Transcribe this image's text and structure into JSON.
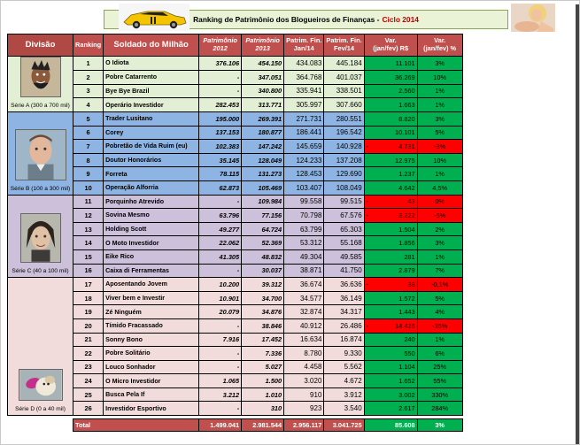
{
  "header": {
    "title": "Ranking de Patrimônio dos Blogueiros de Finanças -",
    "cycle": "Ciclo 2014"
  },
  "columns": {
    "divisao": "Divisão",
    "ranking": "Ranking",
    "soldado": "Soldado do Milhão",
    "p2012": "Patrimônio",
    "p2012y": "2012",
    "p2013": "Patrimônio",
    "p2013y": "2013",
    "jan": "Patrim. Fin.",
    "jany": "Jan/14",
    "fev": "Patrim. Fin.",
    "fevy": "Fev/14",
    "var": "Var.",
    "vary": "(jan/fev) R$",
    "varp": "Var.",
    "varpy": "(jan/fev) %"
  },
  "divisions": [
    {
      "label": "Série A (300 a 700 mil)"
    },
    {
      "label": "Série B (100 a 300 mil)"
    },
    {
      "label": "Série C (40 a 100 mil)"
    },
    {
      "label": "Série D (0 a 40 mil)"
    }
  ],
  "rows": [
    {
      "rank": "1",
      "name": "O Idiota",
      "p2012": "376.106",
      "p2013": "454.150",
      "jan": "434.083",
      "fev": "445.184",
      "var": "11.101",
      "pct": "3%",
      "neg": false
    },
    {
      "rank": "2",
      "name": "Pobre Catarrento",
      "p2012": "-",
      "p2013": "347.051",
      "jan": "364.768",
      "fev": "401.037",
      "var": "36.269",
      "pct": "10%",
      "neg": false
    },
    {
      "rank": "3",
      "name": "Bye Bye Brazil",
      "p2012": "-",
      "p2013": "340.800",
      "jan": "335.941",
      "fev": "338.501",
      "var": "2.560",
      "pct": "1%",
      "neg": false
    },
    {
      "rank": "4",
      "name": "Operário Investidor",
      "p2012": "282.453",
      "p2013": "313.771",
      "jan": "305.997",
      "fev": "307.660",
      "var": "1.663",
      "pct": "1%",
      "neg": false
    },
    {
      "rank": "5",
      "name": "Trader Lusitano",
      "p2012": "195.000",
      "p2013": "269.391",
      "jan": "271.731",
      "fev": "280.551",
      "var": "8.820",
      "pct": "3%",
      "neg": false
    },
    {
      "rank": "6",
      "name": "Corey",
      "p2012": "137.153",
      "p2013": "180.877",
      "jan": "186.441",
      "fev": "196.542",
      "var": "10.101",
      "pct": "5%",
      "neg": false
    },
    {
      "rank": "7",
      "name": "Pobretão de Vida Ruim (eu)",
      "p2012": "102.383",
      "p2013": "147.242",
      "jan": "145.659",
      "fev": "140.928",
      "var": "4.731",
      "pct": "-3%",
      "neg": true
    },
    {
      "rank": "8",
      "name": "Doutor Honorários",
      "p2012": "35.145",
      "p2013": "128.049",
      "jan": "124.233",
      "fev": "137.208",
      "var": "12.975",
      "pct": "10%",
      "neg": false
    },
    {
      "rank": "9",
      "name": "Forreta",
      "p2012": "78.115",
      "p2013": "131.273",
      "jan": "128.453",
      "fev": "129.690",
      "var": "1.237",
      "pct": "1%",
      "neg": false
    },
    {
      "rank": "10",
      "name": "Operação Alforria",
      "p2012": "62.873",
      "p2013": "105.469",
      "jan": "103.407",
      "fev": "108.049",
      "var": "4.642",
      "pct": "4,5%",
      "neg": false
    },
    {
      "rank": "11",
      "name": "Porquinho Atrevido",
      "p2012": "-",
      "p2013": "109.984",
      "jan": "99.558",
      "fev": "99.515",
      "var": "43",
      "pct": "0%",
      "neg": true
    },
    {
      "rank": "12",
      "name": "Sovina Mesmo",
      "p2012": "63.796",
      "p2013": "77.156",
      "jan": "70.798",
      "fev": "67.576",
      "var": "3.222",
      "pct": "-5%",
      "neg": true
    },
    {
      "rank": "13",
      "name": "Holding Scott",
      "p2012": "49.277",
      "p2013": "64.724",
      "jan": "63.799",
      "fev": "65.303",
      "var": "1.504",
      "pct": "2%",
      "neg": false
    },
    {
      "rank": "14",
      "name": "O Moto Investidor",
      "p2012": "22.062",
      "p2013": "52.369",
      "jan": "53.312",
      "fev": "55.168",
      "var": "1.856",
      "pct": "3%",
      "neg": false
    },
    {
      "rank": "15",
      "name": "Eike Rico",
      "p2012": "41.305",
      "p2013": "48.832",
      "jan": "49.304",
      "fev": "49.585",
      "var": "281",
      "pct": "1%",
      "neg": false
    },
    {
      "rank": "16",
      "name": "Caixa di Ferramentas",
      "p2012": "-",
      "p2013": "30.037",
      "jan": "38.871",
      "fev": "41.750",
      "var": "2.879",
      "pct": "7%",
      "neg": false
    },
    {
      "rank": "17",
      "name": "Aposentando Jovem",
      "p2012": "10.200",
      "p2013": "39.312",
      "jan": "36.674",
      "fev": "36.636",
      "var": "38",
      "pct": "-0,1%",
      "neg": true
    },
    {
      "rank": "18",
      "name": "Viver bem e Investir",
      "p2012": "10.901",
      "p2013": "34.700",
      "jan": "34.577",
      "fev": "36.149",
      "var": "1.572",
      "pct": "5%",
      "neg": false
    },
    {
      "rank": "19",
      "name": "Zé Ninguém",
      "p2012": "20.079",
      "p2013": "34.876",
      "jan": "32.874",
      "fev": "34.317",
      "var": "1.443",
      "pct": "4%",
      "neg": false
    },
    {
      "rank": "20",
      "name": "Tímido Fracassado",
      "p2012": "-",
      "p2013": "38.846",
      "jan": "40.912",
      "fev": "26.486",
      "var": "14.426",
      "pct": "-35%",
      "neg": true
    },
    {
      "rank": "21",
      "name": "Sonny Bono",
      "p2012": "7.916",
      "p2013": "17.452",
      "jan": "16.634",
      "fev": "16.874",
      "var": "240",
      "pct": "1%",
      "neg": false
    },
    {
      "rank": "22",
      "name": "Pobre Solitário",
      "p2012": "-",
      "p2013": "7.336",
      "jan": "8.780",
      "fev": "9.330",
      "var": "550",
      "pct": "6%",
      "neg": false
    },
    {
      "rank": "23",
      "name": "Louco Sonhador",
      "p2012": "-",
      "p2013": "5.027",
      "jan": "4.458",
      "fev": "5.562",
      "var": "1.104",
      "pct": "25%",
      "neg": false
    },
    {
      "rank": "24",
      "name": "O Micro Investidor",
      "p2012": "1.065",
      "p2013": "1.500",
      "jan": "3.020",
      "fev": "4.672",
      "var": "1.652",
      "pct": "55%",
      "neg": false
    },
    {
      "rank": "25",
      "name": "Busca Pela If",
      "p2012": "3.212",
      "p2013": "1.010",
      "jan": "910",
      "fev": "3.912",
      "var": "3.002",
      "pct": "330%",
      "neg": false
    },
    {
      "rank": "26",
      "name": "Investidor Esportivo",
      "p2012": "-",
      "p2013": "310",
      "jan": "923",
      "fev": "3.540",
      "var": "2.617",
      "pct": "284%",
      "neg": false
    }
  ],
  "total": {
    "label": "Total",
    "p2012": "1.499.041",
    "p2013": "2.981.544",
    "jan": "2.956.117",
    "fev": "3.041.725",
    "var": "85.608",
    "pct": "3%"
  },
  "colors": {
    "header_red": "#c0504d",
    "positive": "#00b050",
    "negative": "#ff0000",
    "serie_a": "#e3efd4",
    "serie_b": "#8db4e2",
    "serie_c": "#ccc0da",
    "serie_d": "#f2dcdb"
  }
}
